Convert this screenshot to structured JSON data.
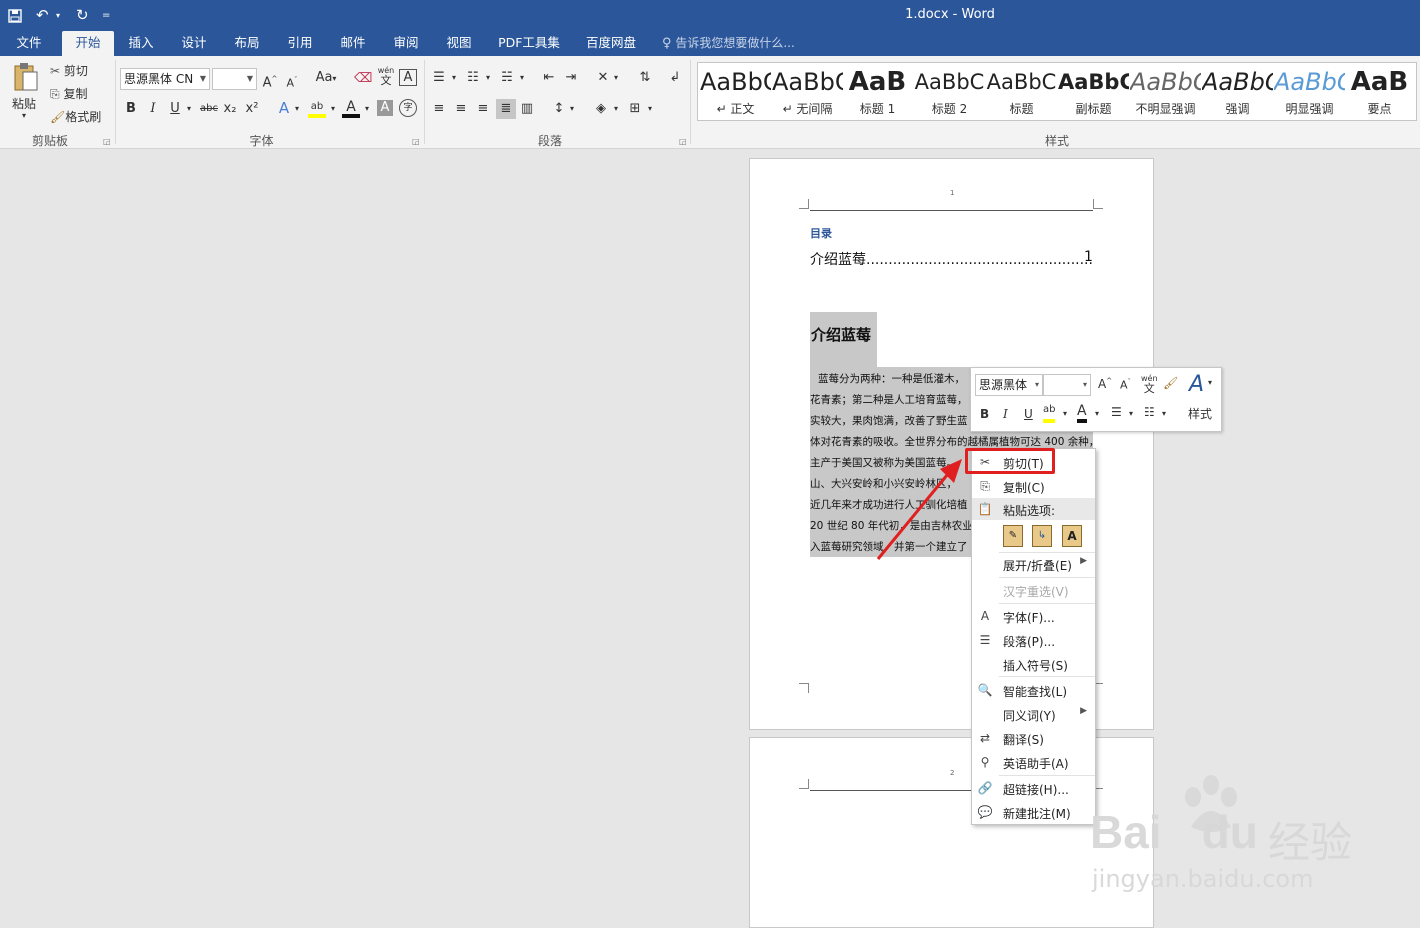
{
  "window": {
    "title": "1.docx - Word",
    "qa_customize": "="
  },
  "tabs": [
    "文件",
    "开始",
    "插入",
    "设计",
    "布局",
    "引用",
    "邮件",
    "审阅",
    "视图",
    "PDF工具集",
    "百度网盘"
  ],
  "tell_me": "告诉我您想要做什么...",
  "clipboard": {
    "paste": "粘贴",
    "cut": "剪切",
    "copy": "复制",
    "format_painter": "格式刷",
    "group": "剪贴板"
  },
  "font": {
    "name": "思源黑体 CN",
    "size": "",
    "case": "Aa",
    "wen": "wén",
    "wen2": "文",
    "A": "A",
    "bold": "B",
    "italic": "I",
    "underline": "U",
    "strike": "abc",
    "sub": "x₂",
    "sup": "x²",
    "zi": "字",
    "group": "字体"
  },
  "paragraph": {
    "group": "段落"
  },
  "styles": {
    "group": "样式",
    "items": [
      {
        "sample": "AaBbCcDd",
        "name": "↵ 正文"
      },
      {
        "sample": "AaBbCcDd",
        "name": "↵ 无间隔"
      },
      {
        "sample": "AaB",
        "name": "标题 1"
      },
      {
        "sample": "AaBbC",
        "name": "标题 2"
      },
      {
        "sample": "AaBbC",
        "name": "标题"
      },
      {
        "sample": "AaBbC",
        "name": "副标题"
      },
      {
        "sample": "AaBbCcDd",
        "name": "不明显强调"
      },
      {
        "sample": "AaBbCcDd",
        "name": "强调"
      },
      {
        "sample": "AaBbCcDd",
        "name": "明显强调"
      },
      {
        "sample": "AaB",
        "name": "要点"
      }
    ]
  },
  "document": {
    "page1_num": "1",
    "page2_num": "2",
    "toc_heading": "目录",
    "toc_entry": "介绍蓝莓....................................................................",
    "toc_page": "1",
    "heading": "介绍蓝莓",
    "lines": [
      "蓝莓分为两种：一种是低灌木，",
      "花青素；第二种是人工培育蓝莓，",
      "实较大，果肉饱满，改善了野生蓝",
      "体对花青素的吸收。全世界分布的越橘属植物可达 400 余种，",
      "主产于美国又被称为美国蓝莓。",
      "山、大兴安岭和小兴安岭林区，",
      "近几年来才成功进行人工驯化培植",
      "20 世纪 80 年代初，是由吉林农业",
      "入蓝莓研究领域，并第一个建立了"
    ]
  },
  "mini_toolbar": {
    "font": "思源黑体",
    "size": "",
    "styles": "样式",
    "bold": "B",
    "italic": "I",
    "underline": "U"
  },
  "context_menu": {
    "cut": "剪切(T)",
    "copy": "复制(C)",
    "paste_options": "粘贴选项:",
    "expand": "展开/折叠(E)",
    "reconvert": "汉字重选(V)",
    "font": "字体(F)...",
    "paragraph": "段落(P)...",
    "insert_symbol": "插入符号(S)",
    "smart_lookup": "智能查找(L)",
    "synonyms": "同义词(Y)",
    "translate": "翻译(S)",
    "english_assistant": "英语助手(A)",
    "hyperlink": "超链接(H)...",
    "new_comment": "新建批注(M)"
  },
  "watermark": {
    "brand": "Bai",
    "brand2": "du",
    "cn": "经验",
    "url": "jingyan.baidu.com"
  },
  "colors": {
    "accent": "#2b579a",
    "highlight_box": "#e02020",
    "selection": "#c8c8c8"
  }
}
